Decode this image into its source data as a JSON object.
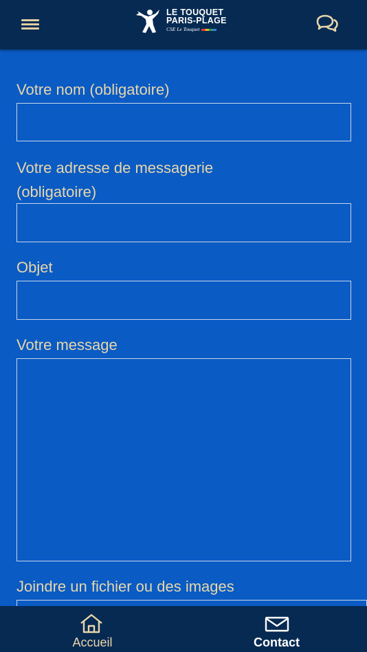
{
  "header": {
    "logo": {
      "line1": "LE TOUQUET",
      "line2": "PARIS-PLAGE",
      "subtitle": "CSE Le Touquet"
    },
    "menu_icon": "hamburger-menu-icon",
    "chat_icon": "chat-bubbles-icon"
  },
  "form": {
    "name_label": "Votre nom (obligatoire)",
    "name_value": "",
    "email_label_line1": "Votre adresse de messagerie",
    "email_label_line2": "(obligatoire)",
    "email_value": "",
    "subject_label": "Objet",
    "subject_value": "",
    "message_label": "Votre message",
    "message_value": "",
    "attach_label": "Joindre un fichier ou des images"
  },
  "bottom_nav": {
    "items": [
      {
        "label": "Accueil",
        "icon": "home-icon",
        "active": false
      },
      {
        "label": "Contact",
        "icon": "envelope-icon",
        "active": true
      }
    ]
  },
  "colors": {
    "header_bg": "#062a52",
    "page_bg": "#0a5bc4",
    "label_text": "#e8d6aa",
    "field_border": "#c9d7e8"
  }
}
